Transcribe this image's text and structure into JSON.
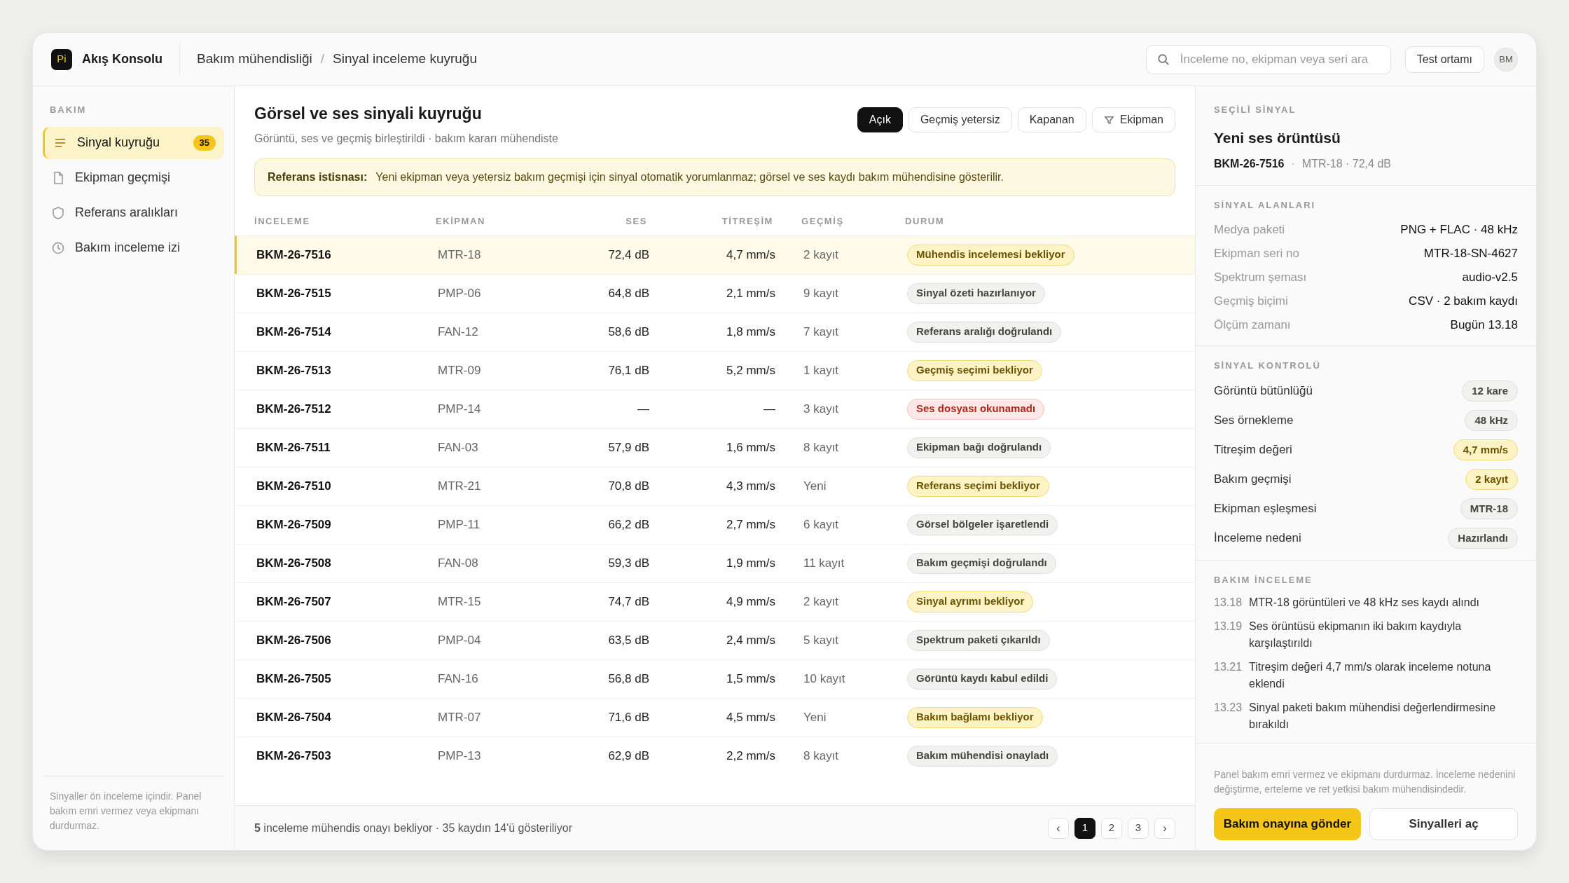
{
  "app": {
    "logo": "Pi",
    "name": "Akış Konsolu"
  },
  "breadcrumb": [
    "Bakım mühendisliği",
    "Sinyal inceleme kuyruğu"
  ],
  "breadcrumb_separator": "/",
  "search": {
    "placeholder": "İnceleme no, ekipman veya seri ara"
  },
  "environment": "Test ortamı",
  "user": "BM",
  "sidebar": {
    "section": "BAKIM",
    "items": [
      {
        "label": "Sinyal kuyruğu",
        "badge": "35",
        "selected": true
      },
      {
        "label": "Ekipman geçmişi",
        "selected": false
      },
      {
        "label": "Referans aralıkları",
        "selected": false
      },
      {
        "label": "Bakım inceleme izi",
        "selected": false
      }
    ],
    "note": "Sinyaller ön inceleme içindir. Panel bakım emri vermez veya ekipmanı durdurmaz."
  },
  "main": {
    "title": "Görsel ve ses sinyali kuyruğu",
    "subtitle": "Görüntü, ses ve geçmiş birleştirildi · bakım kararı mühendiste",
    "filters": [
      {
        "label": "Açık",
        "selected": true
      },
      {
        "label": "Geçmiş yetersiz",
        "selected": false
      },
      {
        "label": "Kapanan",
        "selected": false
      },
      {
        "label": "Ekipman",
        "selected": false,
        "kind": "filter"
      }
    ],
    "notice": {
      "title": "Referans istisnası:",
      "text": "Yeni ekipman veya yetersiz bakım geçmişi için sinyal otomatik yorumlanmaz; görsel ve ses kaydı bakım mühendisine gösterilir."
    }
  },
  "table": {
    "columns": [
      "İNCELEME",
      "EKİPMAN",
      "SES",
      "TİTREŞİM",
      "GEÇMİŞ",
      "DURUM"
    ],
    "rows": [
      {
        "id": "BKM-26-7516",
        "equipment": "MTR-18",
        "sound": "72,4 dB",
        "vibration": "4,7 mm/s",
        "history": "2 kayıt",
        "status": "Mühendis incelemesi bekliyor",
        "kind": "waiting",
        "selected": true
      },
      {
        "id": "BKM-26-7515",
        "equipment": "PMP-06",
        "sound": "64,8 dB",
        "vibration": "2,1 mm/s",
        "history": "9 kayıt",
        "status": "Sinyal özeti hazırlanıyor",
        "kind": "neutral",
        "selected": false
      },
      {
        "id": "BKM-26-7514",
        "equipment": "FAN-12",
        "sound": "58,6 dB",
        "vibration": "1,8 mm/s",
        "history": "7 kayıt",
        "status": "Referans aralığı doğrulandı",
        "kind": "neutral",
        "selected": false
      },
      {
        "id": "BKM-26-7513",
        "equipment": "MTR-09",
        "sound": "76,1 dB",
        "vibration": "5,2 mm/s",
        "history": "1 kayıt",
        "status": "Geçmiş seçimi bekliyor",
        "kind": "waiting",
        "selected": false
      },
      {
        "id": "BKM-26-7512",
        "equipment": "PMP-14",
        "sound": "—",
        "vibration": "—",
        "history": "3 kayıt",
        "status": "Ses dosyası okunamadı",
        "kind": "error",
        "selected": false
      },
      {
        "id": "BKM-26-7511",
        "equipment": "FAN-03",
        "sound": "57,9 dB",
        "vibration": "1,6 mm/s",
        "history": "8 kayıt",
        "status": "Ekipman bağı doğrulandı",
        "kind": "neutral",
        "selected": false
      },
      {
        "id": "BKM-26-7510",
        "equipment": "MTR-21",
        "sound": "70,8 dB",
        "vibration": "4,3 mm/s",
        "history": "Yeni",
        "status": "Referans seçimi bekliyor",
        "kind": "waiting",
        "selected": false
      },
      {
        "id": "BKM-26-7509",
        "equipment": "PMP-11",
        "sound": "66,2 dB",
        "vibration": "2,7 mm/s",
        "history": "6 kayıt",
        "status": "Görsel bölgeler işaretlendi",
        "kind": "neutral",
        "selected": false
      },
      {
        "id": "BKM-26-7508",
        "equipment": "FAN-08",
        "sound": "59,3 dB",
        "vibration": "1,9 mm/s",
        "history": "11 kayıt",
        "status": "Bakım geçmişi doğrulandı",
        "kind": "neutral",
        "selected": false
      },
      {
        "id": "BKM-26-7507",
        "equipment": "MTR-15",
        "sound": "74,7 dB",
        "vibration": "4,9 mm/s",
        "history": "2 kayıt",
        "status": "Sinyal ayrımı bekliyor",
        "kind": "waiting",
        "selected": false
      },
      {
        "id": "BKM-26-7506",
        "equipment": "PMP-04",
        "sound": "63,5 dB",
        "vibration": "2,4 mm/s",
        "history": "5 kayıt",
        "status": "Spektrum paketi çıkarıldı",
        "kind": "neutral",
        "selected": false
      },
      {
        "id": "BKM-26-7505",
        "equipment": "FAN-16",
        "sound": "56,8 dB",
        "vibration": "1,5 mm/s",
        "history": "10 kayıt",
        "status": "Görüntü kaydı kabul edildi",
        "kind": "neutral",
        "selected": false
      },
      {
        "id": "BKM-26-7504",
        "equipment": "MTR-07",
        "sound": "71,6 dB",
        "vibration": "4,5 mm/s",
        "history": "Yeni",
        "status": "Bakım bağlamı bekliyor",
        "kind": "waiting",
        "selected": false
      },
      {
        "id": "BKM-26-7503",
        "equipment": "PMP-13",
        "sound": "62,9 dB",
        "vibration": "2,2 mm/s",
        "history": "8 kayıt",
        "status": "Bakım mühendisi onayladı",
        "kind": "neutral",
        "selected": false
      }
    ]
  },
  "footer": {
    "summary": "**5** inceleme mühendis onayı bekliyor · 35 kaydın 14'ü gösteriliyor",
    "pages": [
      {
        "label": "‹",
        "kind": "arrow",
        "selected": false
      },
      {
        "label": "1",
        "kind": "page",
        "selected": true
      },
      {
        "label": "2",
        "kind": "page",
        "selected": false
      },
      {
        "label": "3",
        "kind": "page",
        "selected": false
      },
      {
        "label": "›",
        "kind": "arrow",
        "selected": false
      }
    ]
  },
  "detail": {
    "section": "SEÇİLİ SİNYAL",
    "title": "Yeni ses örüntüsü",
    "id": "BKM-26-7516",
    "separator": "·",
    "meta": "MTR-18 · 72,4 dB",
    "fields_title": "SİNYAL ALANLARI",
    "fields": [
      {
        "label": "Medya paketi",
        "value": "PNG + FLAC · 48 kHz"
      },
      {
        "label": "Ekipman seri no",
        "value": "MTR-18-SN-4627"
      },
      {
        "label": "Spektrum şeması",
        "value": "audio-v2.5"
      },
      {
        "label": "Geçmiş biçimi",
        "value": "CSV · 2 bakım kaydı"
      },
      {
        "label": "Ölçüm zamanı",
        "value": "Bugün 13.18"
      }
    ],
    "checks_title": "SİNYAL KONTROLÜ",
    "checks": [
      {
        "label": "Görüntü bütünlüğü",
        "value": "12 kare",
        "kind": "neutral"
      },
      {
        "label": "Ses örnekleme",
        "value": "48 kHz",
        "kind": "neutral"
      },
      {
        "label": "Titreşim değeri",
        "value": "4,7 mm/s",
        "kind": "waiting"
      },
      {
        "label": "Bakım geçmişi",
        "value": "2 kayıt",
        "kind": "waiting"
      },
      {
        "label": "Ekipman eşleşmesi",
        "value": "MTR-18",
        "kind": "neutral"
      },
      {
        "label": "İnceleme nedeni",
        "value": "Hazırlandı",
        "kind": "neutral"
      }
    ],
    "log_title": "BAKIM İNCELEME",
    "log": [
      {
        "time": "13.18",
        "text": "MTR-18 görüntüleri ve 48 kHz ses kaydı alındı"
      },
      {
        "time": "13.19",
        "text": "Ses örüntüsü ekipmanın iki bakım kaydıyla karşılaştırıldı"
      },
      {
        "time": "13.21",
        "text": "Titreşim değeri 4,7 mm/s olarak inceleme notuna eklendi"
      },
      {
        "time": "13.23",
        "text": "Sinyal paketi bakım mühendisi değerlendirmesine bırakıldı"
      }
    ],
    "note": "Panel bakım emri vermez ve ekipmanı durdurmaz. İnceleme nedenini değiştirme, erteleme ve ret yetkisi bakım mühendisindedir.",
    "buttons": [
      "Bakım onayına gönder",
      "Sinyalleri aç"
    ]
  }
}
